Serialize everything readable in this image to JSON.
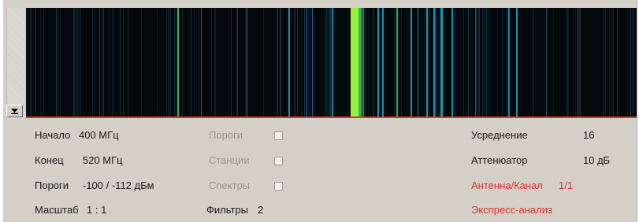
{
  "panel": {
    "start": {
      "label": "Начало",
      "value": "400 МГц"
    },
    "end": {
      "label": "Конец",
      "value": "520 МГц"
    },
    "thresholds_level": {
      "label": "Пороги",
      "value": "-100 / -112 дБм"
    },
    "scale": {
      "label": "Масштаб",
      "value": "1 : 1"
    },
    "filters": {
      "label": "Фильтры",
      "value": "2"
    }
  },
  "options": {
    "thresholds_label": "Пороги",
    "stations_label": "Станции",
    "spectra_label": "Спектры"
  },
  "settings": {
    "averaging": {
      "label": "Усреднение",
      "value": "16"
    },
    "attenuator": {
      "label": "Аттенюатор",
      "value": "10 дБ"
    },
    "antenna_channel": {
      "label": "Антенна/Канал",
      "value": "1/1"
    },
    "express_analysis": "Экспресс-анализ"
  },
  "colors": {
    "background": "#d4d0c8",
    "spectrogram_bg": "#05080a",
    "accent_red": "#e0302a",
    "disabled_text": "#9a968e",
    "signal_cyan": "#1aa7c7",
    "signal_green": "#9cff3a"
  },
  "icons": {
    "scroll_down": "arrow-down-icon"
  }
}
